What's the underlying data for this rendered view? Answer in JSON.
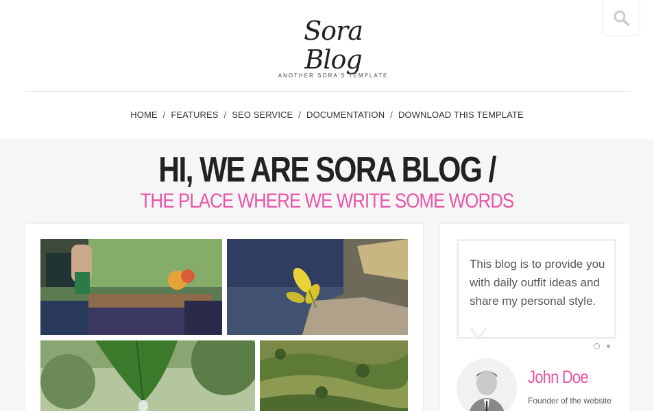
{
  "header": {
    "logo_title": "Sora Blog",
    "logo_tagline": "ANOTHER SORA'S TEMPLATE",
    "search_icon": "search-icon"
  },
  "nav": {
    "items": [
      "HOME",
      "FEATURES",
      "SEO SERVICE",
      "DOCUMENTATION",
      "DOWNLOAD THIS TEMPLATE"
    ],
    "separator": "/"
  },
  "hero": {
    "title": "HI, WE ARE SORA BLOG /",
    "subtitle": "THE PLACE WHERE WE WRITE SOME WORDS"
  },
  "sidebar": {
    "quote": "This blog is to provide you with daily outfit ideas and share my personal style.",
    "author_name": "John Doe",
    "author_role": "Founder of the website"
  },
  "colors": {
    "accent": "#e955a8",
    "text": "#222222"
  }
}
